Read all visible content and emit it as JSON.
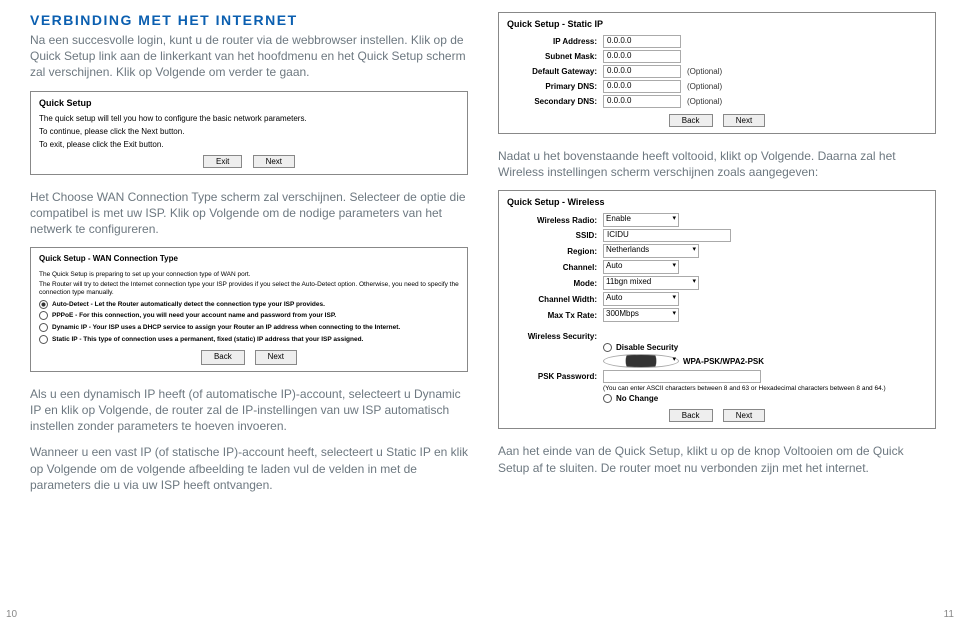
{
  "heading": "VERBINDING MET HET INTERNET",
  "intro": "Na een succesvolle login, kunt u de router via de webbrowser instellen. Klik op de Quick Setup link aan de linkerkant van het hoofdmenu en het Quick Setup scherm zal verschijnen. Klik op Volgende om verder te gaan.",
  "qs": {
    "title": "Quick Setup",
    "line1": "The quick setup will tell you how to configure the basic network parameters.",
    "line2": "To continue, please click the Next button.",
    "line3": "To exit, please click the Exit button.",
    "exit": "Exit",
    "next": "Next"
  },
  "mid": "Het Choose WAN Connection Type scherm zal verschijnen. Selecteer de optie die compatibel is met uw ISP. Klik op Volgende om de nodige parameters van het netwerk te configureren.",
  "wan": {
    "title": "Quick Setup - WAN Connection Type",
    "l1": "The Quick Setup is preparing to set up your connection type of WAN port.",
    "l2": "The Router will try to detect the Internet connection type your ISP provides if you select the Auto-Detect option. Otherwise, you need to specify the connection type manually.",
    "r1": "Auto-Detect - Let the Router automatically detect the connection type your ISP provides.",
    "r2": "PPPoE - For this connection, you will need your account name and password from your ISP.",
    "r3": "Dynamic IP - Your ISP uses a DHCP service to assign your Router an IP address when connecting to the Internet.",
    "r4": "Static IP - This type of connection uses a permanent, fixed (static) IP address that your ISP assigned.",
    "back": "Back",
    "next": "Next"
  },
  "afterwan1": "Als u een dynamisch IP heeft (of automatische IP)-account, selecteert u Dynamic IP en klik op Volgende, de router zal de IP-instellingen van uw ISP automatisch instellen zonder parameters te hoeven invoeren.",
  "afterwan2": "Wanneer u een vast IP (of statische IP)-account heeft, selecteert u Static IP en klik op Volgende om de volgende afbeelding te laden vul de velden in met de parameters die u via uw ISP heeft ontvangen.",
  "static": {
    "title": "Quick Setup - Static IP",
    "ip_l": "IP Address:",
    "ip_v": "0.0.0.0",
    "sm_l": "Subnet Mask:",
    "sm_v": "0.0.0.0",
    "gw_l": "Default Gateway:",
    "gw_v": "0.0.0.0",
    "opt": "(Optional)",
    "pd_l": "Primary DNS:",
    "pd_v": "0.0.0.0",
    "sd_l": "Secondary DNS:",
    "sd_v": "0.0.0.0",
    "back": "Back",
    "next": "Next"
  },
  "afterstatic": "Nadat u het bovenstaande heeft voltooid, klikt op Volgende. Daarna zal het Wireless instellingen scherm verschijnen zoals aangegeven:",
  "wl": {
    "title": "Quick Setup - Wireless",
    "radio_l": "Wireless Radio:",
    "radio_v": "Enable",
    "ssid_l": "SSID:",
    "ssid_v": "ICIDU",
    "region_l": "Region:",
    "region_v": "Netherlands",
    "chan_l": "Channel:",
    "chan_v": "Auto",
    "mode_l": "Mode:",
    "mode_v": "11bgn mixed",
    "cw_l": "Channel Width:",
    "cw_v": "Auto",
    "tx_l": "Max Tx Rate:",
    "tx_v": "300Mbps",
    "sec_l": "Wireless Security:",
    "dis": "Disable Security",
    "wpa": "WPA-PSK/WPA2-PSK",
    "psk_l": "PSK Password:",
    "psk_note": "(You can enter ASCII characters between 8 and 63 or Hexadecimal characters between 8 and 64.)",
    "nochg": "No Change",
    "back": "Back",
    "next": "Next"
  },
  "closing": "Aan het einde van de Quick Setup, klikt u op de knop Voltooien om de Quick Setup af te sluiten. De router moet nu verbonden zijn met het internet.",
  "pg_left": "10",
  "pg_right": "11"
}
